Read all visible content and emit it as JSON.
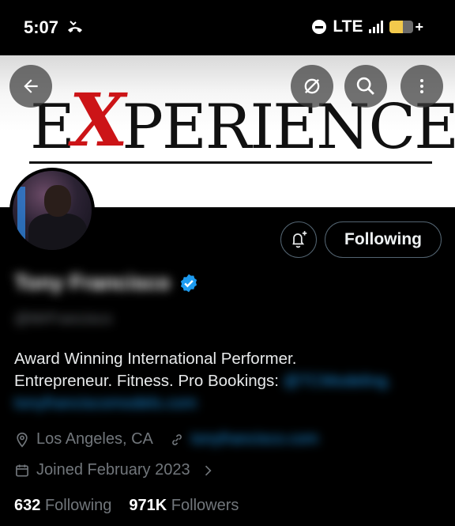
{
  "status_bar": {
    "time": "5:07",
    "call_icon": "missed-call-icon",
    "network": "LTE",
    "dnd_icon": "do-not-disturb-icon",
    "battery_level": 0.55,
    "battery_charging_symbol": "+"
  },
  "banner": {
    "text_left": "E",
    "text_x": "X",
    "text_right": "PERIENCE",
    "accent_color": "#cc1417"
  },
  "top_actions": {
    "back_icon": "back-arrow-icon",
    "spaces_icon": "slashed-circle-icon",
    "search_icon": "search-icon",
    "more_icon": "more-vertical-icon"
  },
  "profile": {
    "name": "Tony Francisco",
    "verified_color": "#1d9bf0",
    "handle": "@MrFrancisco",
    "bio_line1": "Award Winning International Performer.",
    "bio_line2_text": "Entrepreneur. Fitness. Pro Bookings: ",
    "bio_line2_link": "@TCModeling.",
    "bio_line3_link": "tonyfranciscomodels.com",
    "location": "Los Angeles, CA",
    "website": "tonyfrancisco.com",
    "joined": "Joined February 2023",
    "following_count": "632",
    "following_label": "Following",
    "followers_count": "971K",
    "followers_label": "Followers"
  },
  "actions": {
    "notify_icon": "bell-plus-icon",
    "following_button": "Following"
  }
}
